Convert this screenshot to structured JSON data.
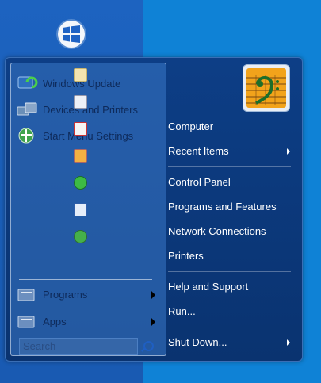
{
  "left_items": [
    {
      "label": "Windows Update",
      "icon": "windows-update-icon"
    },
    {
      "label": "Devices and Printers",
      "icon": "devices-printers-icon"
    },
    {
      "label": "Start Menu Settings",
      "icon": "start-menu-settings-icon"
    }
  ],
  "left_bottom": [
    {
      "label": "Programs",
      "icon": "programs-folder-icon"
    },
    {
      "label": "Apps",
      "icon": "apps-folder-icon"
    }
  ],
  "search": {
    "placeholder": "Search"
  },
  "right_items": [
    {
      "label": "Computer"
    },
    {
      "label": "Recent Items"
    },
    {
      "label": "Control Panel"
    },
    {
      "label": "Programs and Features"
    },
    {
      "label": "Network Connections"
    },
    {
      "label": "Printers"
    },
    {
      "label": "Help and Support"
    },
    {
      "label": "Run..."
    },
    {
      "label": "Shut Down..."
    }
  ],
  "pinned_icons": [
    "note-icon",
    "font-icon",
    "fms-icon",
    "paint-icon",
    "ie-icon",
    "word-icon",
    "green-app-icon"
  ],
  "colors": {
    "desktop": "#0f82d6",
    "menu": "#0d3e86",
    "taskbar": "#1a5fb9"
  }
}
